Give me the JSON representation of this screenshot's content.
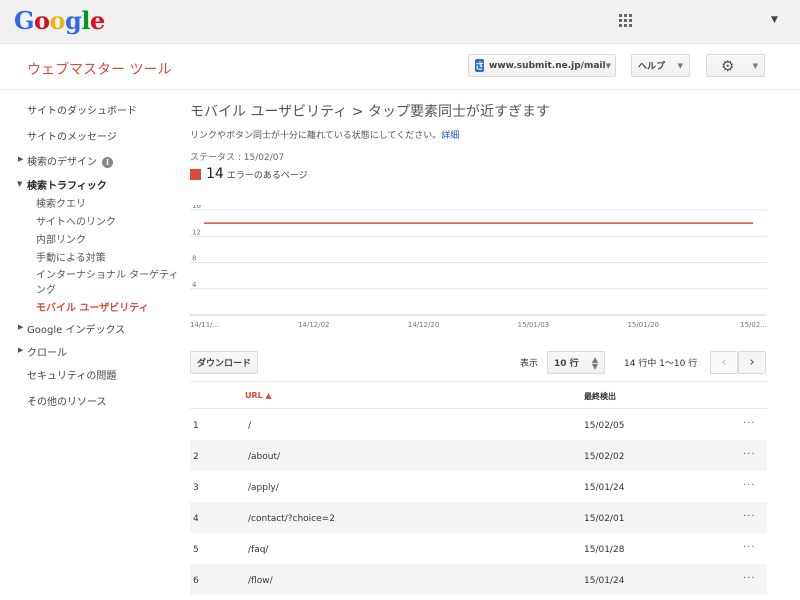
{
  "header": {
    "logo_letters": [
      {
        "char": "G",
        "color": "#3369e8"
      },
      {
        "char": "o",
        "color": "#d50f25"
      },
      {
        "char": "o",
        "color": "#eeb211"
      },
      {
        "char": "g",
        "color": "#3369e8"
      },
      {
        "char": "l",
        "color": "#009925"
      },
      {
        "char": "e",
        "color": "#d50f25"
      }
    ],
    "apps_icon": "apps-grid-icon",
    "account_caret": "▼"
  },
  "product": {
    "title": "ウェブマスター ツール",
    "site": "www.submit.ne.jp/mail",
    "site_favicon": "さ",
    "help_label": "ヘルプ",
    "settings_icon": "gear-icon"
  },
  "sidebar": {
    "items": [
      {
        "label": "サイトのダッシュボード"
      },
      {
        "label": "サイトのメッセージ"
      },
      {
        "label": "検索のデザイン"
      },
      {
        "label": "検索トラフィック"
      },
      {
        "label": "検索クエリ"
      },
      {
        "label": "サイトへのリンク"
      },
      {
        "label": "内部リンク"
      },
      {
        "label": "手動による対策"
      },
      {
        "label": "インターナショナル ターゲティ"
      },
      {
        "label": "ング"
      },
      {
        "label": "モバイル ユーザビリティ"
      },
      {
        "label": "Google インデックス"
      },
      {
        "label": "クロール"
      },
      {
        "label": "セキュリティの問題"
      },
      {
        "label": "その他のリソース"
      }
    ]
  },
  "main": {
    "title": "モバイル ユーザビリティ > タップ要素同士が近すぎます",
    "description": "リンクやボタン同士が十分に離れている状態にしてください。",
    "details_link": "詳細",
    "status": "ステータス : 15/02/07",
    "error_count": "14",
    "error_label": "エラーのあるページ",
    "error_color": "#dd4b39",
    "download_label": "ダウンロード",
    "show_label": "表示",
    "rows_per_page": "10 行",
    "range_text": "14 行中 1〜10 行"
  },
  "chart_data": {
    "type": "line",
    "x": [
      "14/11/...",
      "14/12/02",
      "14/12/20",
      "15/01/03",
      "15/01/20",
      "15/02..."
    ],
    "series": [
      {
        "values": [
          14,
          14,
          14,
          14,
          14,
          14
        ],
        "color": "#dd4b39"
      }
    ],
    "yticks": [
      "16",
      "12",
      "8",
      "4"
    ],
    "ylim": [
      0,
      16
    ],
    "grid": true
  },
  "table": {
    "headers": {
      "url": "URL ▲",
      "last_detected": "最終検出"
    },
    "rows": [
      {
        "num": "1",
        "url": "/",
        "date": "15/02/05"
      },
      {
        "num": "2",
        "url": "/about/",
        "date": "15/02/02"
      },
      {
        "num": "3",
        "url": "/apply/",
        "date": "15/01/24"
      },
      {
        "num": "4",
        "url": "/contact/?choice=2",
        "date": "15/02/01"
      },
      {
        "num": "5",
        "url": "/faq/",
        "date": "15/01/28"
      },
      {
        "num": "6",
        "url": "/flow/",
        "date": "15/01/24"
      }
    ],
    "more_glyph": "···"
  }
}
